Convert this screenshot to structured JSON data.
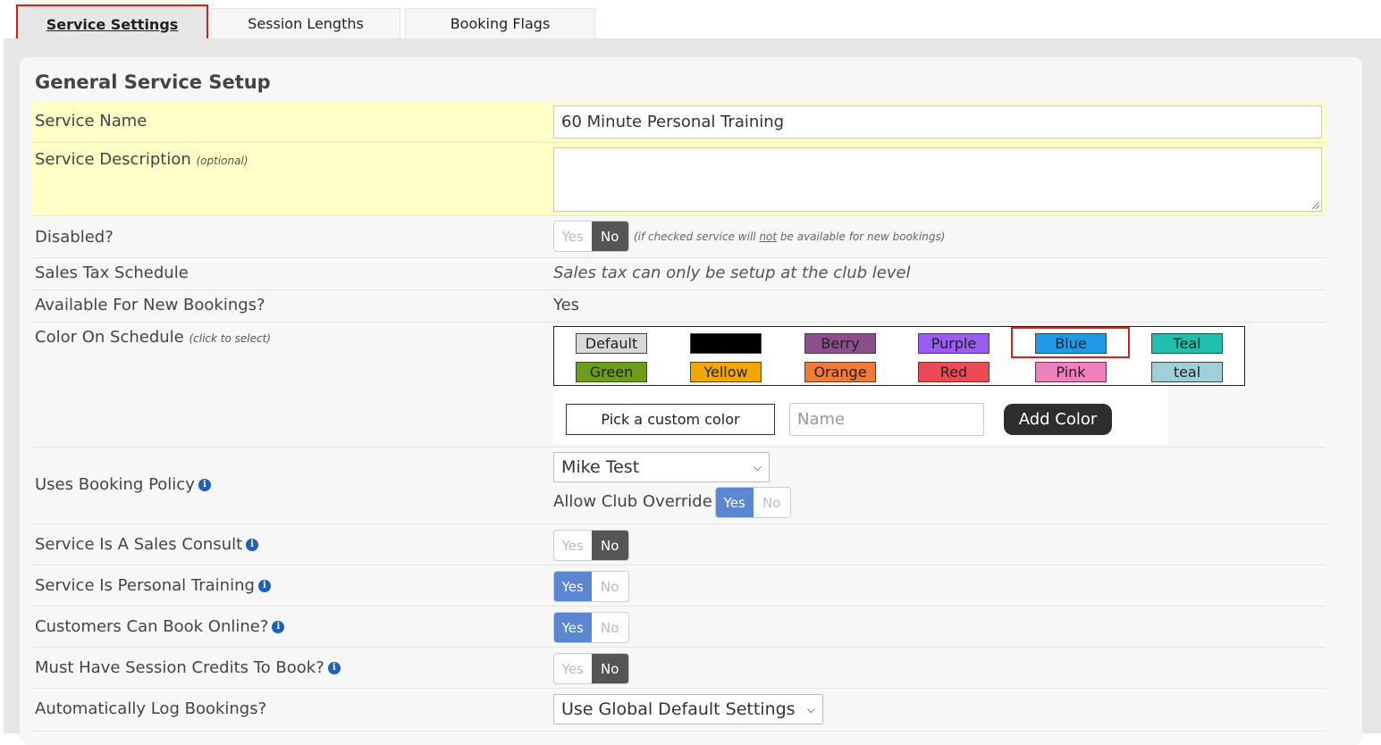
{
  "tabs": [
    {
      "label": "Service Settings",
      "active": true
    },
    {
      "label": "Session Lengths",
      "active": false
    },
    {
      "label": "Booking Flags",
      "active": false
    }
  ],
  "section_title": "General Service Setup",
  "service_name": {
    "label": "Service Name",
    "value": "60 Minute Personal Training"
  },
  "service_description": {
    "label": "Service Description",
    "note": "(optional)",
    "value": ""
  },
  "disabled": {
    "label": "Disabled?",
    "yes": "Yes",
    "no": "No",
    "selected": "No",
    "hint_pre": "(if checked service will ",
    "hint_not": "not",
    "hint_post": " be available for new bookings)"
  },
  "sales_tax": {
    "label": "Sales Tax Schedule",
    "value": "Sales tax can only be setup at the club level"
  },
  "available": {
    "label": "Available For New Bookings?",
    "value": "Yes"
  },
  "color": {
    "label": "Color On Schedule",
    "note": "(click to select)",
    "selected": "Blue",
    "swatches": [
      {
        "name": "Default",
        "color": "#d9d9d9"
      },
      {
        "name": "",
        "color": "#000000"
      },
      {
        "name": "Berry",
        "color": "#8a4f8a"
      },
      {
        "name": "Purple",
        "color": "#9b5cf0"
      },
      {
        "name": "Blue",
        "color": "#1f9ae8"
      },
      {
        "name": "Teal",
        "color": "#1fbfad"
      },
      {
        "name": "Green",
        "color": "#6e9d1a"
      },
      {
        "name": "Yellow",
        "color": "#f0a800"
      },
      {
        "name": "Orange",
        "color": "#f07a3a"
      },
      {
        "name": "Red",
        "color": "#ee4a55"
      },
      {
        "name": "Pink",
        "color": "#ef7fbd"
      },
      {
        "name": "teal",
        "color": "#9fcfd8"
      }
    ],
    "custom_button": "Pick a custom color",
    "name_placeholder": "Name",
    "add_button": "Add Color"
  },
  "booking_policy": {
    "label": "Uses Booking Policy",
    "value": "Mike Test",
    "override_label": "Allow Club Override",
    "override_selected": "Yes"
  },
  "sales_consult": {
    "label": "Service Is A Sales Consult",
    "selected": "No"
  },
  "personal_training": {
    "label": "Service Is Personal Training",
    "selected": "Yes"
  },
  "book_online": {
    "label": "Customers Can Book Online?",
    "selected": "Yes"
  },
  "session_credits": {
    "label": "Must Have Session Credits To Book?",
    "selected": "No"
  },
  "auto_log": {
    "label": "Automatically Log Bookings?",
    "value": "Use Global Default Settings"
  },
  "toggle_labels": {
    "yes": "Yes",
    "no": "No"
  },
  "info_glyph": "i"
}
